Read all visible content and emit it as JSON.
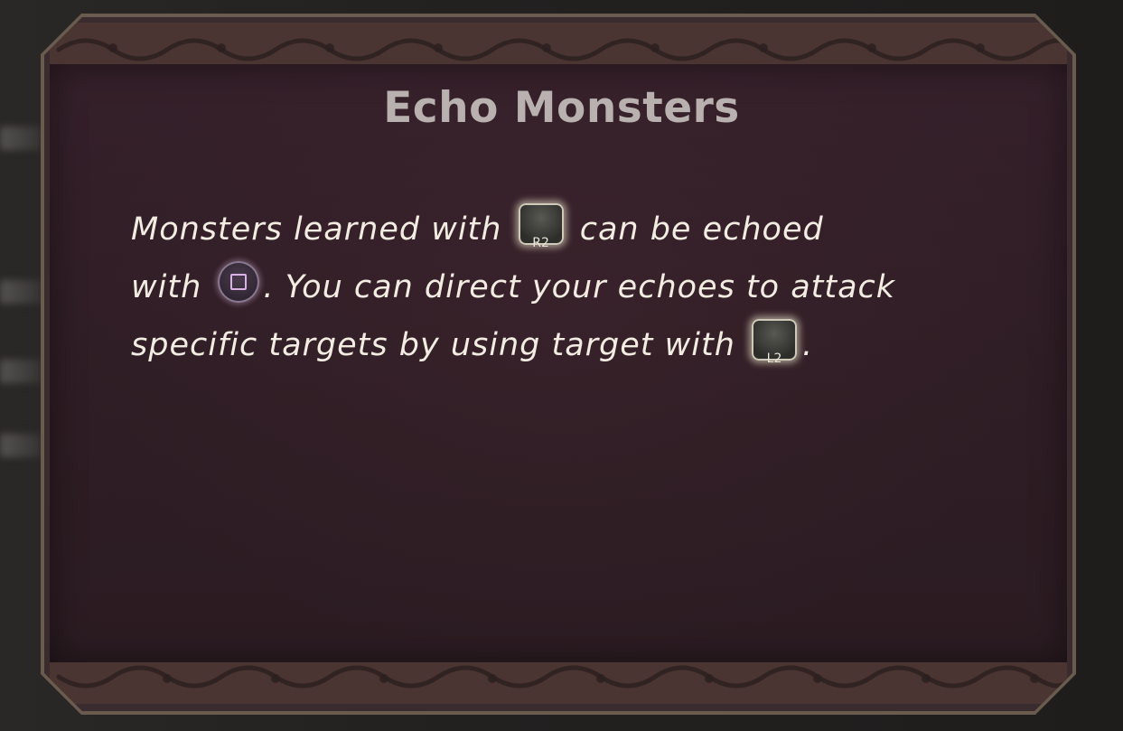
{
  "dialog": {
    "title": "Echo Monsters",
    "lines": [
      {
        "before": "Monsters learned with ",
        "button": "R2",
        "after": " can be echoed"
      },
      {
        "before": "with ",
        "button_icon": "square-button-icon",
        "after": ". You can direct your echoes to attack"
      },
      {
        "before": "specific targets by using target with ",
        "button": "L2",
        "after": "."
      }
    ]
  },
  "colors": {
    "frame": "#6a5b4f",
    "panel": "#2e1d24",
    "title": "#b8b1b0",
    "text": "#f2ece2"
  }
}
